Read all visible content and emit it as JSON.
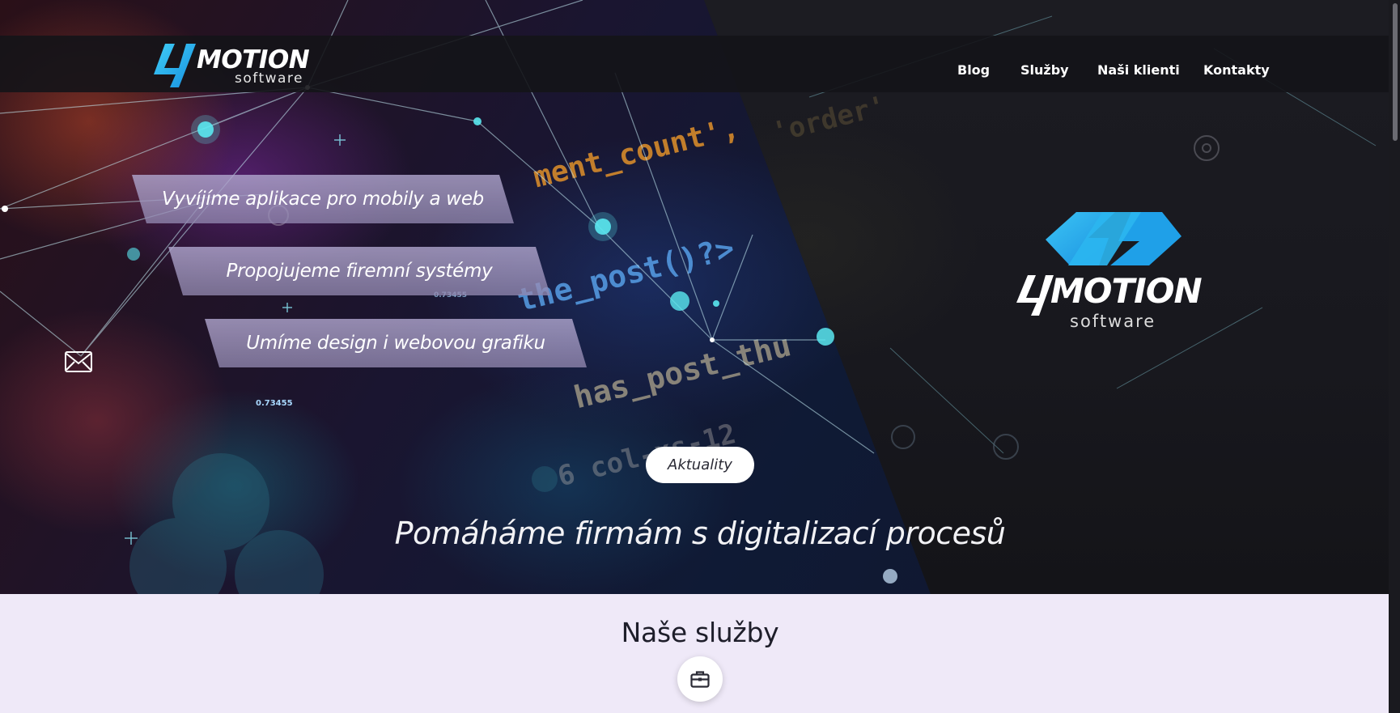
{
  "brand": {
    "name": "MOTION",
    "digit": "4",
    "tagline": "software"
  },
  "nav": {
    "items": [
      {
        "label": "Blog"
      },
      {
        "label": "Služby"
      },
      {
        "label": "Naši klienti"
      },
      {
        "label": "Kontakty"
      }
    ]
  },
  "hero": {
    "slogans": [
      "Vyvíjíme aplikace pro mobily a web",
      "Propojujeme firemní systémy",
      "Umíme design i webovou grafiku"
    ],
    "news_button": "Aktuality",
    "headline": "Pomáháme firmám s digitalizací procesů",
    "background_code": [
      "ment_count',",
      "the_post()?>",
      "has_post_thu",
      "6 col-xs-12",
      "'order'"
    ],
    "background_numbers": [
      "0.73455",
      "0.73455"
    ]
  },
  "services": {
    "title": "Naše služby",
    "icon": "briefcase-icon"
  },
  "colors": {
    "accent": "#1fa3e6",
    "accent_light": "#36c3f5",
    "header_bg": "#141418",
    "services_bg": "#efe9f8"
  }
}
